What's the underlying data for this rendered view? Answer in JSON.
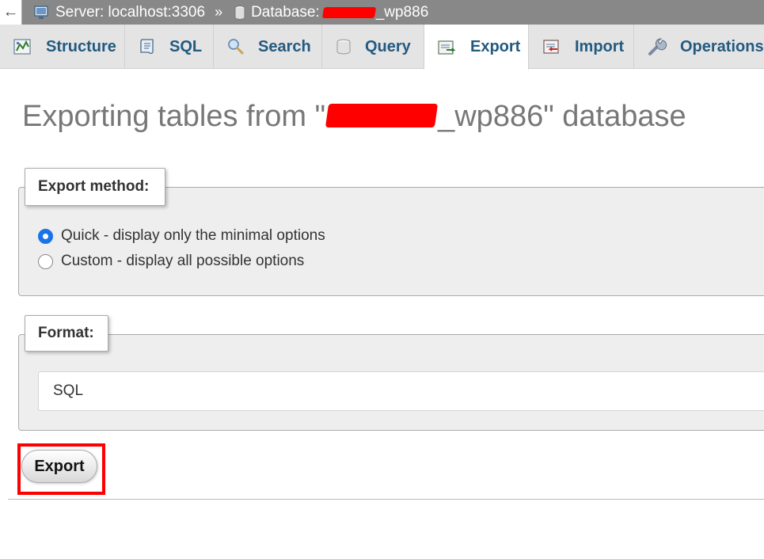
{
  "breadcrumb": {
    "back_label": "←",
    "server_label": "Server: localhost:3306",
    "separator": "»",
    "database_prefix": "Database: ",
    "database_suffix": "_wp886"
  },
  "tabs": [
    {
      "label": "Structure",
      "icon": "structure-icon"
    },
    {
      "label": "SQL",
      "icon": "sql-icon"
    },
    {
      "label": "Search",
      "icon": "search-icon"
    },
    {
      "label": "Query",
      "icon": "query-icon"
    },
    {
      "label": "Export",
      "icon": "export-icon",
      "active": true
    },
    {
      "label": "Import",
      "icon": "import-icon"
    },
    {
      "label": "Operations",
      "icon": "operations-icon"
    }
  ],
  "page": {
    "title_prefix": "Exporting tables from \"",
    "title_suffix": "_wp886\" database"
  },
  "export_method": {
    "legend": "Export method:",
    "options": [
      {
        "label": "Quick - display only the minimal options",
        "checked": true
      },
      {
        "label": "Custom - display all possible options",
        "checked": false
      }
    ]
  },
  "format": {
    "legend": "Format:",
    "selected": "SQL"
  },
  "actions": {
    "export_label": "Export"
  },
  "colors": {
    "tab_text": "#235a81",
    "topbar": "#888888",
    "highlight": "#ff0000",
    "radio_accent": "#1a73e8"
  }
}
